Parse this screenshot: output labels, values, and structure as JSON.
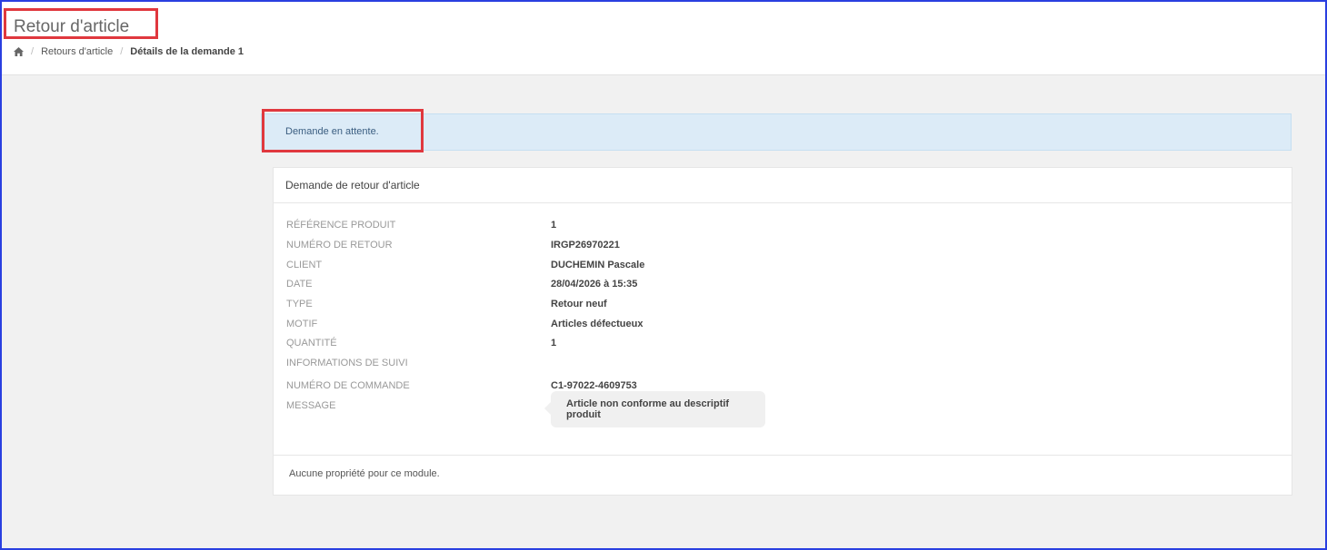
{
  "header": {
    "title": "Retour d'article",
    "breadcrumb": {
      "home_icon": "home-icon",
      "items": [
        "Retours d'article",
        "Détails de la demande 1"
      ]
    }
  },
  "alert": {
    "text": "Demande en attente."
  },
  "panel": {
    "heading": "Demande de retour d'article",
    "fields": [
      {
        "label": "RÉFÉRENCE PRODUIT",
        "value": "1"
      },
      {
        "label": "NUMÉRO DE RETOUR",
        "value": "IRGP26970221"
      },
      {
        "label": "CLIENT",
        "value": "DUCHEMIN Pascale"
      },
      {
        "label": "DATE",
        "value": "28/04/2026 à 15:35"
      },
      {
        "label": "TYPE",
        "value": "Retour neuf"
      },
      {
        "label": "MOTIF",
        "value": "Articles défectueux"
      },
      {
        "label": "QUANTITÉ",
        "value": "1"
      },
      {
        "label": "INFORMATIONS DE SUIVI",
        "value": ""
      },
      {
        "label": "NUMÉRO DE COMMANDE",
        "value": "C1-97022-4609753"
      },
      {
        "label": "MESSAGE",
        "value": "Article non conforme au descriptif produit"
      }
    ],
    "footer": "Aucune propriété pour ce module."
  },
  "colors": {
    "highlight": "#e0383e",
    "alert_bg": "#dcebf7",
    "frame": "#2a3fe0"
  }
}
